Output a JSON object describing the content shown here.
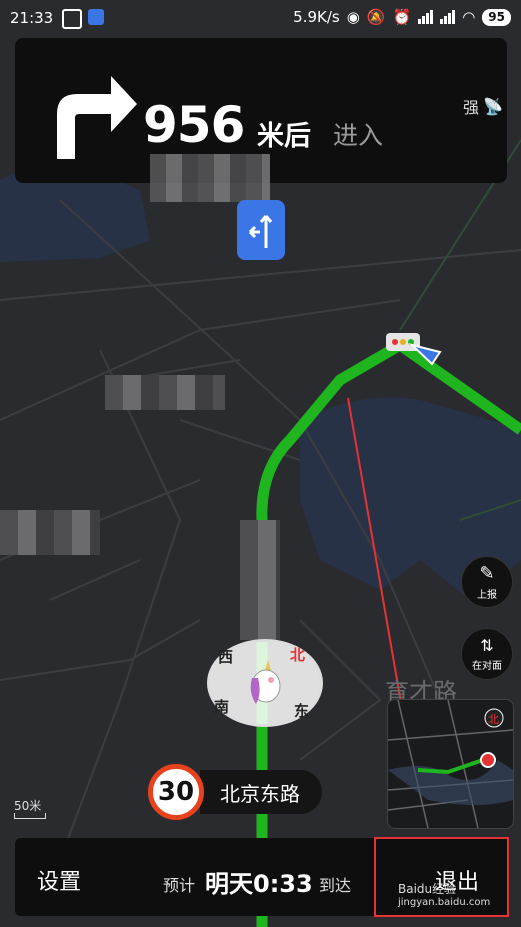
{
  "status_bar": {
    "time": "21:33",
    "network_speed": "5.9K/s",
    "battery": "95"
  },
  "nav": {
    "distance": "956",
    "distance_unit": "米后",
    "action": "进入",
    "signal_label": "强"
  },
  "map": {
    "district_label": "育才路",
    "compass": {
      "north": "北",
      "south": "南",
      "east": "东",
      "west": "西"
    }
  },
  "side_buttons": {
    "report": "上报",
    "opposite": "在对面"
  },
  "speed_limit": "30",
  "road_name": "北京东路",
  "scale_label": "50米",
  "bottom": {
    "settings": "设置",
    "eta_prefix": "预计",
    "eta_time": "明天0:33",
    "eta_suffix": "到达",
    "exit": "退出"
  },
  "watermark": {
    "line1": "Baidu经验",
    "line2": "jingyan.baidu.com"
  },
  "colors": {
    "route": "#1fb51f",
    "lane": "#3a76e6",
    "speed_ring": "#e8421d",
    "annotation": "#e53333"
  }
}
